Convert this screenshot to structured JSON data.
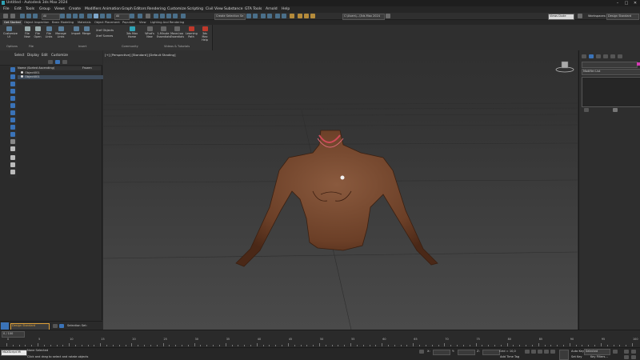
{
  "app": {
    "title": "Untitled - Autodesk 3ds Max 2024"
  },
  "window_controls": {
    "minimize": "–",
    "maximize": "□",
    "close": "✕"
  },
  "menu": [
    "File",
    "Edit",
    "Tools",
    "Group",
    "Views",
    "Create",
    "Modifiers",
    "Animation",
    "Graph Editors",
    "Rendering",
    "Customize",
    "Scripting",
    "Civil View",
    "Substance",
    "GTA Tools",
    "Arnold",
    "Help"
  ],
  "toolbar": {
    "view_dropdown": "All",
    "create_selection_set": "Create Selection Se",
    "path_dropdown": "C:\\Users\\...\\3ds Max 2024",
    "view_mode": "Views Dude",
    "workspace_label": "Workspaces:",
    "workspace_value": "Design Standard"
  },
  "ribbon_tabs": [
    "Get Started",
    "Object Inspection",
    "Basic Modeling",
    "Materials",
    "Object Placement",
    "Populate",
    "View",
    "Lighting And Rendering"
  ],
  "ribbon": {
    "buttons": [
      {
        "label": "Customize UI"
      },
      {
        "label": "File New"
      },
      {
        "label": "File Open"
      },
      {
        "label": "File Links"
      },
      {
        "label": "Manage Links"
      },
      {
        "label": "Import"
      },
      {
        "label": "Merge"
      },
      {
        "label": "3ds Max Home"
      },
      {
        "label": "What's New"
      },
      {
        "label": "1-Minute Essentials"
      },
      {
        "label": "Move-too Essentials"
      },
      {
        "label": "Learning Path"
      },
      {
        "label": "3ds Max Help"
      }
    ],
    "side_buttons": [
      "Xref Objects",
      "Xref Scenes"
    ],
    "groups": [
      "Options",
      "File",
      "Insert",
      "Community",
      "Videos & Tutorials"
    ]
  },
  "explorer": {
    "menu": [
      "Select",
      "Display",
      "Edit",
      "Customize"
    ],
    "header_name": "Name (Sorted Ascending)",
    "header_frozen": "Frozen",
    "rows": [
      {
        "label": "Object001"
      },
      {
        "label": "Object001"
      }
    ],
    "workspace_dropdown": "Design Standard",
    "selection_set": "Selection Set:"
  },
  "viewport": {
    "label": "[+] [Perspective] [Standard] [Default Shading]"
  },
  "command_panel": {
    "modifier_list": "Modifier List"
  },
  "timeline": {
    "frame_counter": "0 / 100",
    "ticks": [
      "0",
      "5",
      "10",
      "15",
      "20",
      "25",
      "30",
      "35",
      "40",
      "45",
      "50",
      "55",
      "60",
      "65",
      "70",
      "75",
      "80",
      "85",
      "90",
      "95",
      "100"
    ]
  },
  "status": {
    "maxscript": "MAXScript Mi",
    "status_text": "None Selected",
    "prompt": "Click and drag to select and rotate objects",
    "x_label": "X:",
    "y_label": "Y:",
    "z_label": "Z:",
    "grid": "Grid = 10,0",
    "add_time_tag": "Add Time Tag",
    "auto_key": "Auto Key",
    "set_key": "Set Key",
    "selected": "Selected",
    "key_filters": "Key Filters..."
  },
  "colors": {
    "accent": "#3a73b8",
    "viewport_bg": "#3c3c3c",
    "workspace_highlight": "#e0a23a"
  }
}
